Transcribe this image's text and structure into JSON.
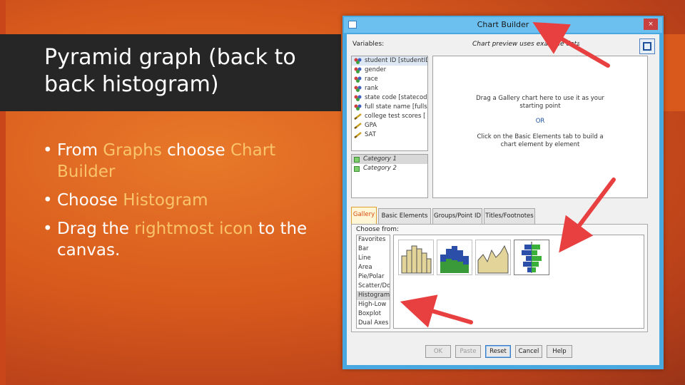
{
  "slide": {
    "title": "Pyramid graph (back to back histogram)",
    "bullets": [
      {
        "parts": [
          {
            "t": "From ",
            "hl": false
          },
          {
            "t": "Graphs",
            "hl": true
          },
          {
            "t": " choose ",
            "hl": false
          },
          {
            "t": "Chart Builder",
            "hl": true
          }
        ]
      },
      {
        "parts": [
          {
            "t": "Choose ",
            "hl": false
          },
          {
            "t": "Histogram",
            "hl": true
          }
        ]
      },
      {
        "parts": [
          {
            "t": "Drag the ",
            "hl": false
          },
          {
            "t": "rightmost icon",
            "hl": true
          },
          {
            "t": " to the canvas.",
            "hl": false
          }
        ]
      }
    ],
    "bullet_char": "•",
    "highlight_color": "#f9c46b"
  },
  "dialog": {
    "title": "Chart Builder",
    "close_glyph": "×",
    "variables_label": "Variables:",
    "preview_note": "Chart preview uses example data",
    "variables": [
      {
        "label": "student ID [studentID]",
        "icon": "nominal-icon"
      },
      {
        "label": "gender",
        "icon": "nominal-icon"
      },
      {
        "label": "race",
        "icon": "nominal-icon"
      },
      {
        "label": "rank",
        "icon": "nominal-icon"
      },
      {
        "label": "state code [statecode]",
        "icon": "nominal-icon"
      },
      {
        "label": "full state name [fullst...",
        "icon": "nominal-icon"
      },
      {
        "label": "college test scores [",
        "icon": "scale-icon"
      },
      {
        "label": "GPA",
        "icon": "scale-icon"
      },
      {
        "label": "SAT",
        "icon": "scale-icon"
      }
    ],
    "categories": [
      "Category 1",
      "Category 2"
    ],
    "canvas": {
      "line1": "Drag a Gallery chart here to use it as your",
      "line2": "starting point",
      "or": "OR",
      "line3": "Click on the Basic Elements tab to build a",
      "line4": "chart element by element"
    },
    "tabs": [
      "Gallery",
      "Basic Elements",
      "Groups/Point ID",
      "Titles/Footnotes"
    ],
    "choose_from_label": "Choose from:",
    "chart_types": [
      "Favorites",
      "Bar",
      "Line",
      "Area",
      "Pie/Polar",
      "Scatter/Dot",
      "Histogram",
      "High-Low",
      "Boxplot",
      "Dual Axes"
    ],
    "selected_chart_type": "Histogram",
    "gallery_icons": [
      "simple-histogram-icon",
      "stacked-histogram-icon",
      "frequency-polygon-icon",
      "population-pyramid-icon"
    ],
    "buttons": [
      "OK",
      "Paste",
      "Reset",
      "Cancel",
      "Help"
    ]
  },
  "colors": {
    "background": "#d85a1c",
    "title_band": "#262626",
    "window_border": "#4aa8e0",
    "arrow": "#e84040"
  }
}
